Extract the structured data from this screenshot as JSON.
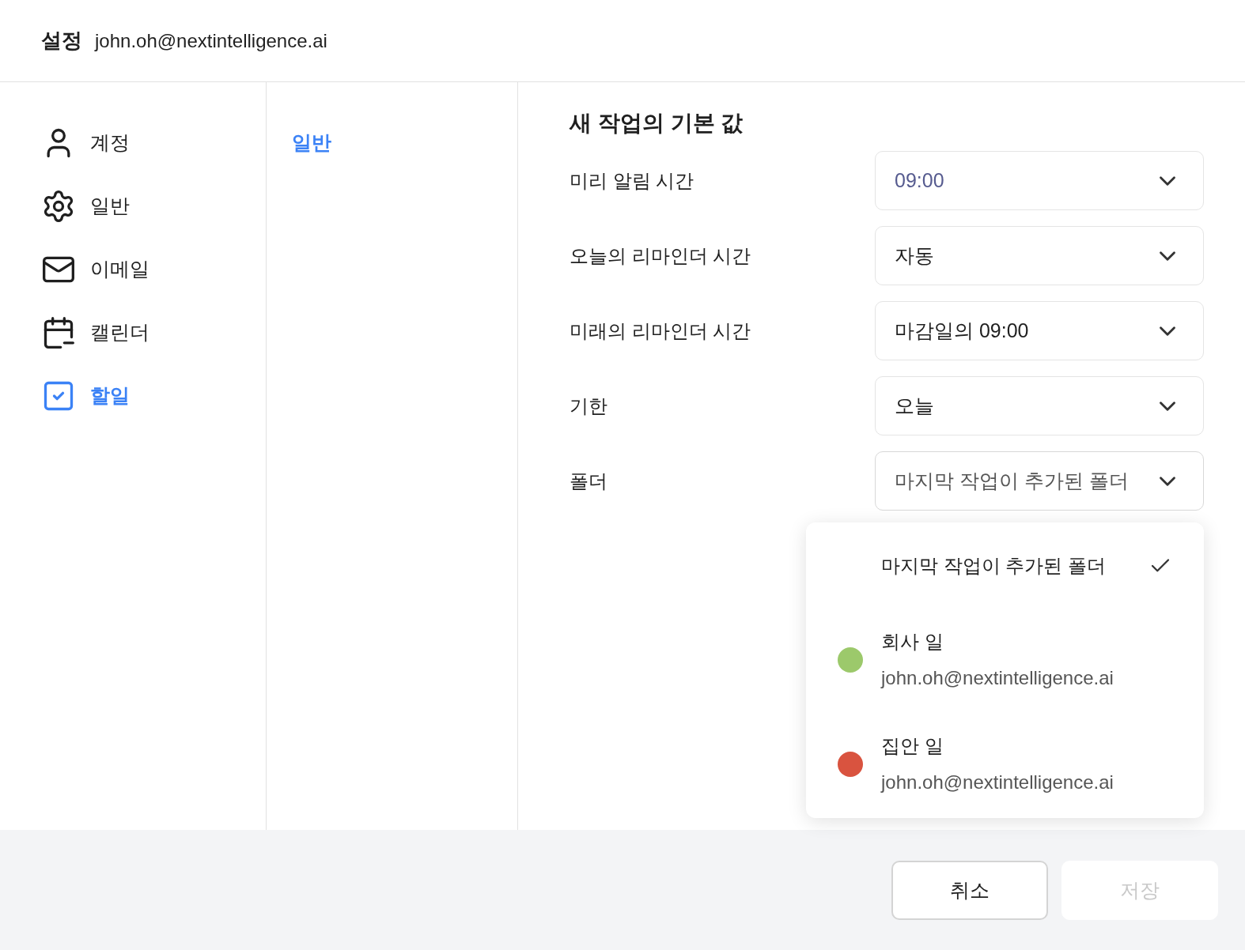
{
  "header": {
    "title": "설정",
    "account": "john.oh@nextintelligence.ai"
  },
  "sidebar": {
    "items": [
      {
        "label": "계정",
        "kind": "user",
        "selected": false
      },
      {
        "label": "일반",
        "kind": "gear",
        "selected": false
      },
      {
        "label": "이메일",
        "kind": "mail",
        "selected": false
      },
      {
        "label": "캘린더",
        "kind": "calendar",
        "selected": false
      },
      {
        "label": "할일",
        "kind": "todo",
        "selected": true
      }
    ]
  },
  "subnav": {
    "items": [
      {
        "label": "일반",
        "selected": true
      }
    ]
  },
  "section": {
    "title": "새 작업의 기본 값",
    "settings": [
      {
        "label": "미리 알림 시간",
        "value": "09:00",
        "focused": true,
        "open": false
      },
      {
        "label": "오늘의 리마인더 시간",
        "value": "자동",
        "focused": false,
        "open": false
      },
      {
        "label": "미래의 리마인더 시간",
        "value": "마감일의 09:00",
        "focused": false,
        "open": false
      },
      {
        "label": "기한",
        "value": "오늘",
        "focused": false,
        "open": false
      },
      {
        "label": "폴더",
        "value": "마지막 작업이 추가된 폴더",
        "focused": false,
        "open": true
      }
    ]
  },
  "dropdown": {
    "options": [
      {
        "label": "마지막 작업이 추가된 폴더",
        "selected": true
      },
      {
        "label": "회사 일",
        "account": "john.oh@nextintelligence.ai",
        "color": "#9cc96b",
        "selected": false
      },
      {
        "label": "집안 일",
        "account": "john.oh@nextintelligence.ai",
        "color": "#d9533f",
        "selected": false
      }
    ]
  },
  "footer": {
    "buttons": [
      {
        "label": "취소",
        "disabled": false
      },
      {
        "label": "저장",
        "disabled": true
      }
    ]
  }
}
